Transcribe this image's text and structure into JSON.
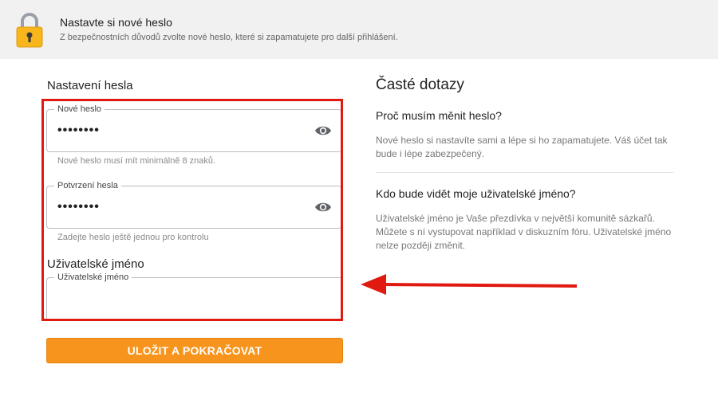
{
  "banner": {
    "title": "Nastavte si nové heslo",
    "subtitle": "Z bezpečnostních důvodů zvolte nové heslo, které si zapamatujete pro další přihlášení."
  },
  "form": {
    "section_title": "Nastavení hesla",
    "new_password": {
      "label": "Nové heslo",
      "value": "••••••••",
      "hint": "Nové heslo musí mít minimálně 8 znaků."
    },
    "confirm_password": {
      "label": "Potvrzení hesla",
      "value": "••••••••",
      "hint": "Zadejte heslo ještě jednou pro kontrolu"
    },
    "username_section_title": "Uživatelské jméno",
    "username": {
      "label": "Uživatelské jméno",
      "value": ""
    },
    "submit_label": "ULOŽIT A POKRAČOVAT"
  },
  "faq": {
    "title": "Časté dotazy",
    "items": [
      {
        "question": "Proč musím měnit heslo?",
        "answer": "Nové heslo si nastavíte sami a lépe si ho zapamatujete. Váš účet tak bude i lépe zabezpečený."
      },
      {
        "question": "Kdo bude vidět moje uživatelské jméno?",
        "answer": "Uživatelské jméno je Vaše přezdívka v největší komunitě sázkařů. Můžete s ní vystupovat například v diskuzním fóru. Uživatelské jméno nelze později změnit."
      }
    ]
  },
  "colors": {
    "accent": "#f7941d",
    "highlight": "#e11a11",
    "banner_bg": "#f1f1f1"
  },
  "icons": {
    "lock": "lock-icon",
    "eye": "eye-icon",
    "arrow": "arrow-left-annotation"
  }
}
